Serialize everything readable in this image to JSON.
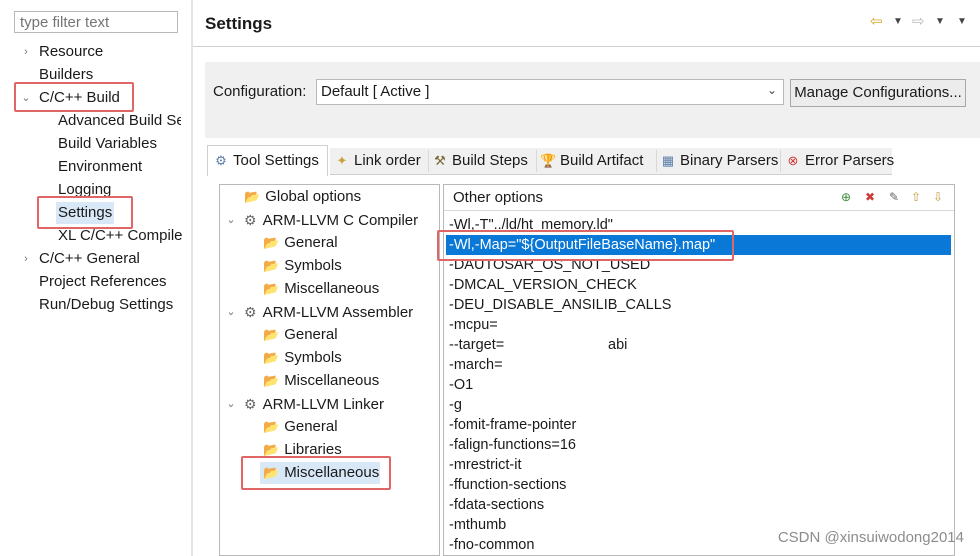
{
  "left_nav": {
    "filter_placeholder": "type filter text",
    "items": [
      {
        "label": "Resource"
      },
      {
        "label": "Builders"
      },
      {
        "label": "C/C++ Build"
      },
      {
        "label": "Advanced Build Se"
      },
      {
        "label": "Build Variables"
      },
      {
        "label": "Environment"
      },
      {
        "label": "Logging"
      },
      {
        "label": "Settings"
      },
      {
        "label": "XL C/C++ Compile"
      },
      {
        "label": "C/C++ General"
      },
      {
        "label": "Project References"
      },
      {
        "label": "Run/Debug Settings"
      }
    ]
  },
  "header": {
    "title": "Settings"
  },
  "config": {
    "label": "Configuration:",
    "value": "Default  [ Active ]",
    "manage_button": "Manage Configurations..."
  },
  "tabs": [
    {
      "label": "Tool Settings",
      "icon": "tool-settings-icon"
    },
    {
      "label": "Link order",
      "icon": "link-order-icon"
    },
    {
      "label": "Build Steps",
      "icon": "build-steps-icon"
    },
    {
      "label": "Build Artifact",
      "icon": "build-artifact-icon"
    },
    {
      "label": "Binary Parsers",
      "icon": "binary-parsers-icon"
    },
    {
      "label": "Error Parsers",
      "icon": "error-parsers-icon"
    }
  ],
  "tool_tree": [
    {
      "label": "Global options"
    },
    {
      "label": "ARM-LLVM C Compiler"
    },
    {
      "label": "General"
    },
    {
      "label": "Symbols"
    },
    {
      "label": "Miscellaneous"
    },
    {
      "label": "ARM-LLVM Assembler"
    },
    {
      "label": "General"
    },
    {
      "label": "Symbols"
    },
    {
      "label": "Miscellaneous"
    },
    {
      "label": "ARM-LLVM Linker"
    },
    {
      "label": "General"
    },
    {
      "label": "Libraries"
    },
    {
      "label": "Miscellaneous"
    }
  ],
  "other_options": {
    "title": "Other options",
    "items": [
      "-Wl,-T\"../ld/ht_memory.ld\"",
      "-Wl,-Map=\"${OutputFileBaseName}.map\"",
      "-DAUTOSAR_OS_NOT_USED",
      "-DMCAL_VERSION_CHECK",
      "-DEU_DISABLE_ANSILIB_CALLS",
      "-mcpu=",
      "--target=",
      "-march=",
      "-O1",
      "-g",
      "-fomit-frame-pointer",
      "-falign-functions=16",
      "-mrestrict-it",
      "-ffunction-sections",
      "-fdata-sections",
      "-mthumb",
      "-fno-common"
    ],
    "target_suffix": "abi"
  },
  "watermark": "CSDN @xinsuiwodong2014",
  "colors": {
    "selection": "#0a78d7",
    "highlight_box": "#e06666"
  }
}
